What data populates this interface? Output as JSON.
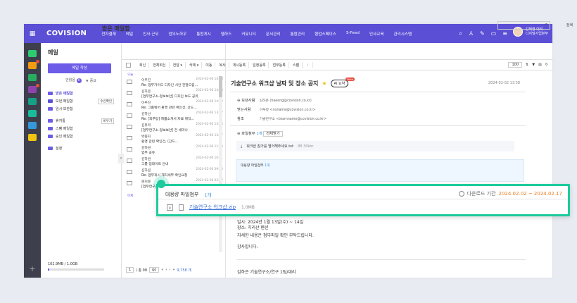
{
  "topbar": {
    "logo": "COVISION",
    "nav": [
      "전자결재",
      "메일",
      "인사·근무",
      "업무노하우",
      "통합게시",
      "웹하드",
      "커뮤니티",
      "문서관리",
      "통합관리",
      "협업스페이스",
      "S-Feed",
      "인사교육",
      "관리시스템"
    ],
    "user_name": "김혜영 대리",
    "user_dept": "디지털사업본부"
  },
  "sidebar": {
    "title": "메일",
    "write_label": "메일 작성",
    "unread_label": "안읽음",
    "unread_count": "0",
    "important_label": "중요",
    "folders": [
      {
        "label": "받은 메일함",
        "active": true
      },
      {
        "label": "보낸 메일함",
        "tag": "수신확인"
      },
      {
        "label": "임시 보관함"
      },
      {
        "label": "휴지통",
        "tag": "비우기"
      },
      {
        "label": "스팸 메일함"
      },
      {
        "label": "승인 메일함"
      },
      {
        "label": "설정"
      }
    ],
    "storage": "102.9MB / 1.0GB",
    "storage_fraction": 0.03
  },
  "list": {
    "page_title": "받은 메일함",
    "search_option": "검색",
    "toolbar": [
      "회신",
      "전체회신",
      "전달 ▾",
      "삭제 ▾",
      "이동",
      "복사",
      "게시등록",
      "일정등록",
      "업무등록",
      "스팸",
      "⋮"
    ],
    "page_size": "100",
    "group_label": "오늘",
    "rows": [
      {
        "from": "이우진",
        "date": "2024-02-06 14:28",
        "subject": "Re: 업무가이드 디자인 시안 전달드립..."
      },
      {
        "from": "김하은",
        "date": "2024-02-06 14:05",
        "subject": "[업무연구소-정보보안] 디자인 보드 공유"
      },
      {
        "from": "이우진",
        "date": "2024-02-06 14:02",
        "subject": "Re: 그룹웨어 환경 관련 확인건, 간드..."
      },
      {
        "from": "김하선",
        "date": "2024-02-06 13:57",
        "subject": "Re: [외부망] 제품소개서 자료 제작..."
      },
      {
        "from": "김유리",
        "date": "2024-02-06 13:24",
        "subject": "[업무연구소-정보보안] 전 세미나"
      },
      {
        "from": "박중지",
        "date": "2024-02-06 13:07",
        "subject": "환경 관련 확인건, (간드..."
      },
      {
        "from": "김하원",
        "date": "2024-02-06 11:09",
        "subject": "업무 공유"
      },
      {
        "from": "김하원",
        "date": "2024-02-06 10:51",
        "subject": "그룹 업데이트 안내"
      },
      {
        "from": "김하원",
        "date": "2024-02-06 09:28",
        "subject": "Re: 업무게시 해지세부 확인요청"
      },
      {
        "from": "문지윤",
        "date": "2024-02-06 02:37",
        "subject": "[업무연구소-정보보안] 공지부"
      }
    ],
    "yesterday_label": "어제",
    "pager_page": "1",
    "pager_total": "/ 총 98",
    "pager_go": "go",
    "pager_count": "9,758 개"
  },
  "read": {
    "title": "기술연구소 워크샵 날짜 및 장소 공지",
    "ai_label": "AI 요약",
    "beta": "Beta",
    "date": "2024-02-02 13:58",
    "sender_label": "보낸사람",
    "sender": "김하은 (haeeng@covision.co.kr)",
    "receiver_label": "받는사람",
    "receiver": "이우정 <noname@covision.co.kr>",
    "cc_label": "참조",
    "cc": "기술연구소 <teamname@covision.co.kr>",
    "attach_label": "파일첨부",
    "attach_count": "1개",
    "attach_toggle": "전체받기",
    "attach_file": "워크샵 참가를 열어해주세요.txt",
    "attach_size": "88.30kbr",
    "bulk_label": "대용량 파일첨부",
    "bulk_count": "1개",
    "body": [
      "일시: 2024년 1월 13일(수) ~ 14일",
      "장소: 치리산 펜션",
      "자세한 내용은 첨부파일 확인 부탁드립니다.",
      "감사합니다."
    ],
    "signature": "김하은 기술연구소/연구 1팀/대리"
  },
  "callout": {
    "label": "대용량 파일첨부",
    "count": "1개",
    "period_label": "다운로드 기간",
    "period": "2024.02.02 ~ 2024.02.17",
    "file": "기술연구소 워크샵.zip",
    "size": "1.0MB"
  },
  "colors": {
    "brand": "#5b4fd6",
    "highlight": "#1ecb9d",
    "period": "#e67e22"
  }
}
